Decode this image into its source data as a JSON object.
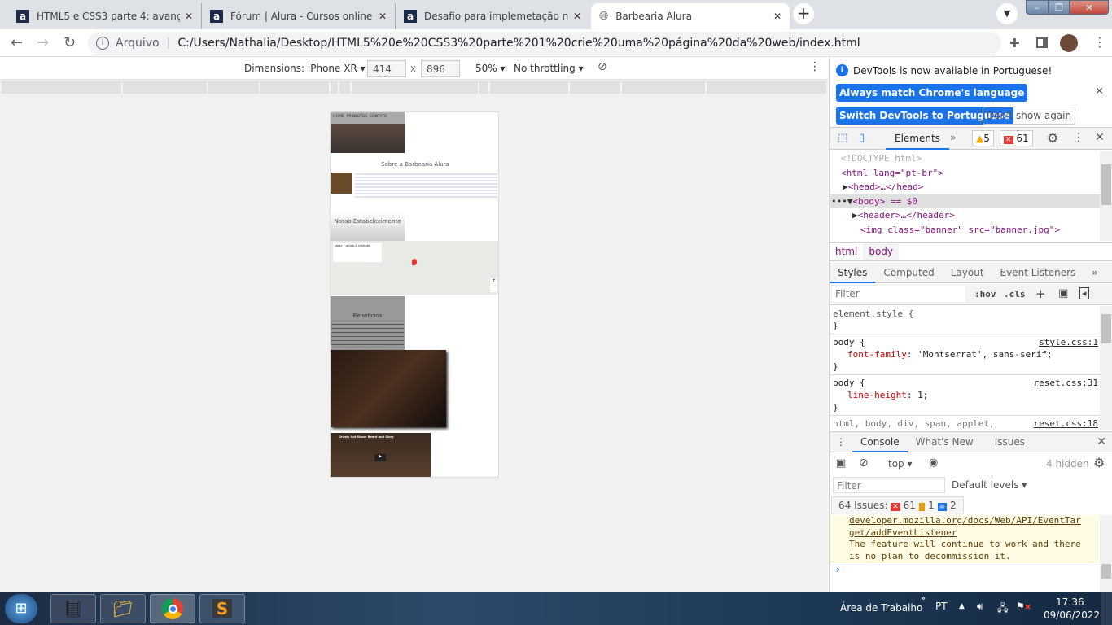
{
  "browser": {
    "tabs": [
      {
        "title": "HTML5 e CSS3 parte 4: avançand",
        "icon": "alura-icon"
      },
      {
        "title": "Fórum | Alura - Cursos online de",
        "icon": "alura-icon"
      },
      {
        "title": "Desafio para implemetação na ab",
        "icon": "alura-icon"
      },
      {
        "title": "Barbearia Alura",
        "icon": "globe-icon",
        "active": true
      }
    ],
    "address": {
      "scheme_label": "Arquivo",
      "url": "C:/Users/Nathalia/Desktop/HTML5%20e%20CSS3%20parte%201%20crie%20uma%20página%20da%20web/index.html"
    }
  },
  "device_toolbar": {
    "dimensions": "Dimensions: iPhone XR",
    "width": "414",
    "height": "896",
    "x": "x",
    "zoom": "50%",
    "throttling": "No throttling"
  },
  "preview": {
    "nav": [
      "HOME",
      "PRODUTOS",
      "CONTATO"
    ],
    "about_title": "Sobre a Barbearia Alura",
    "establishment_title": "Nosso Estabelecimento",
    "map_card_title": "salon • saúde & nutrição",
    "benefits_title": "Benefícios",
    "video_title": "Grizzly Cut Shave Beard and Glory"
  },
  "devtools": {
    "banner": {
      "message": "DevTools is now available in Portuguese!",
      "match_button": "Always match Chrome's language",
      "switch_button": "Switch DevTools to Portuguese",
      "dismiss_button": "Don't show again"
    },
    "main_tab": "Elements",
    "warnings": "5",
    "errors": "61",
    "dom": [
      "<!DOCTYPE html>",
      "<html lang=\"pt-br\">",
      "<head>…</head>",
      "<body> == $0",
      "<header>…</header>",
      "<img class=\"banner\" src=\"banner.jpg\">"
    ],
    "breadcrumbs": [
      "html",
      "body"
    ],
    "style_tabs": [
      "Styles",
      "Computed",
      "Layout",
      "Event Listeners"
    ],
    "filter_placeholder": "Filter",
    "hov": ":hov",
    "cls": ".cls",
    "rules": [
      {
        "selector": "element.style {",
        "prop": "",
        "value": "",
        "source": ""
      },
      {
        "selector": "body {",
        "prop": "font-family",
        "value": "'Montserrat', sans-serif;",
        "source": "style.css:1"
      },
      {
        "selector": "body {",
        "prop": "line-height",
        "value": "1;",
        "source": "reset.css:31"
      },
      {
        "selector": "html, body, div, span, applet,",
        "prop": "",
        "value": "",
        "source": "reset.css:18"
      }
    ],
    "drawer_tabs": [
      "Console",
      "What's New",
      "Issues"
    ],
    "console": {
      "context": "top",
      "hidden": "4 hidden",
      "filter_placeholder": "Filter",
      "levels": "Default levels",
      "issues_label": "64 Issues:",
      "issues_errors": "61",
      "issues_warnings": "1",
      "issues_info": "2",
      "link1": "developer.mozilla.org/docs/Web/API/EventTar",
      "link2": "get/addEventListener",
      "msg1": "The feature will continue to work and there",
      "msg2": "is no plan to decommission it."
    }
  },
  "taskbar": {
    "desktop": "Área de Trabalho",
    "lang": "PT",
    "time": "17:36",
    "date": "09/06/2022"
  },
  "colors": {
    "accent": "#1a73e8",
    "taskbar": "#1d2c44"
  }
}
